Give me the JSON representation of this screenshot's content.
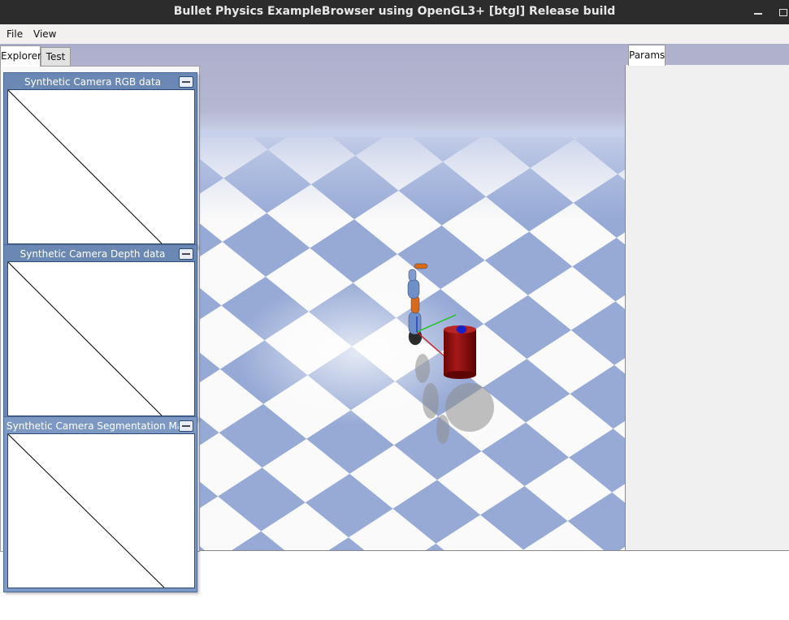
{
  "window": {
    "title": "Bullet Physics ExampleBrowser using OpenGL3+ [btgl] Release build"
  },
  "menu": {
    "file": "File",
    "view": "View"
  },
  "explorer": {
    "tabs": [
      "Explorer",
      "Test"
    ]
  },
  "params": {
    "tab": "Params"
  },
  "camera_windows": [
    {
      "title": "Synthetic Camera RGB data"
    },
    {
      "title": "Synthetic Camera Depth data"
    },
    {
      "title": "Synthetic Camera Segmentation Mask"
    }
  ],
  "scene": {
    "sky_color": "#b0b2cd",
    "floor_light": "#ffffff",
    "floor_tile": "#9fb0d8",
    "robot_color": "#6f8fc8",
    "robot_joint_color": "#d86a1a",
    "cylinder_color": "#8c0a0a"
  }
}
